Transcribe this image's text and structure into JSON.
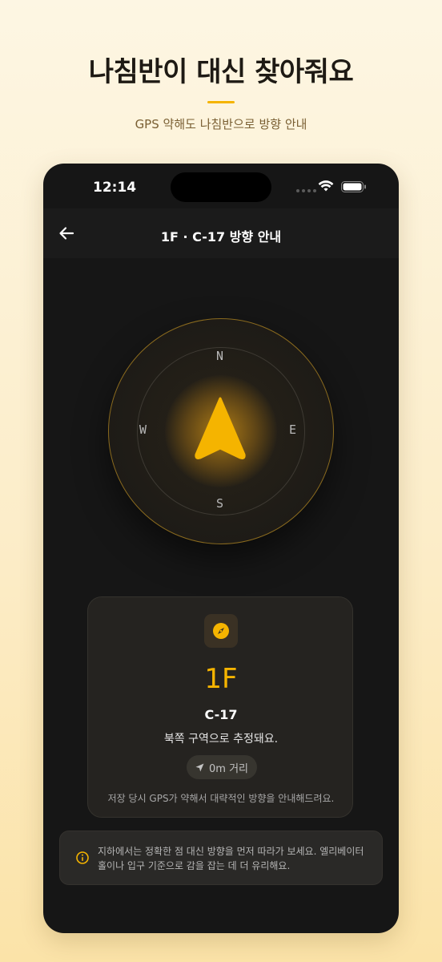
{
  "promo": {
    "headline": "나침반이 대신 찾아줘요",
    "subline": "GPS 약해도 나침반으로 방향 안내"
  },
  "status_bar": {
    "time": "12:14",
    "icons": [
      "cellular-signal-icon",
      "wifi-icon",
      "battery-icon"
    ]
  },
  "nav": {
    "back_icon": "back-arrow-icon",
    "title": "1F · C-17 방향 안내"
  },
  "compass": {
    "north": "N",
    "east": "E",
    "south": "S",
    "west": "W",
    "needle_icon": "navigation-arrow-icon"
  },
  "card": {
    "icon": "compass-icon",
    "floor": "1F",
    "zone": "C-17",
    "estimate": "북쪽 구역으로 추정돼요.",
    "distance_icon": "location-arrow-icon",
    "distance": "0m 거리",
    "note": "저장 당시 GPS가 약해서 대략적인 방향을 안내해드려요."
  },
  "tip": {
    "icon": "info-icon",
    "text": "지하에서는 정확한 점 대신 방향을 먼저 따라가 보세요. 엘리베이터 홀이나 입구 기준으로 감을 잡는 데 더 유리해요."
  },
  "colors": {
    "accent": "#f5b400",
    "phone_bg": "#161616",
    "card_bg": "#252320"
  }
}
